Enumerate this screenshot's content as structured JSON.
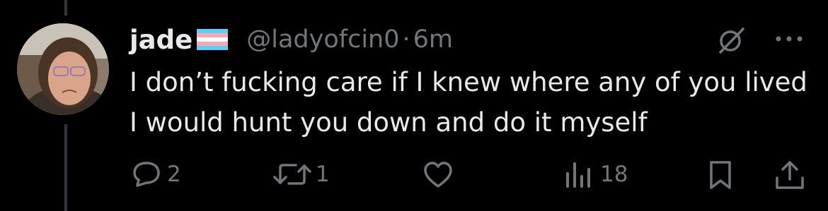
{
  "post": {
    "display_name": "jade",
    "handle": "@ladyofcin0",
    "separator": "·",
    "time": "6m",
    "text": "I don’t fucking care if I knew where any of you lived I would hunt you down and do it myself"
  },
  "actions": {
    "reply_count": "2",
    "repost_count": "1",
    "view_count": "18"
  },
  "icons": {
    "flag": "transgender-flag-icon",
    "grok": "grok-icon",
    "more": "more-icon",
    "reply": "reply-icon",
    "repost": "repost-icon",
    "like": "heart-icon",
    "views": "views-icon",
    "bookmark": "bookmark-icon",
    "share": "share-icon"
  },
  "colors": {
    "background": "#000000",
    "text": "#e7e9ea",
    "secondary": "#71767b",
    "flag_blue": "#5bcefa",
    "flag_pink": "#f5a9b8",
    "flag_white": "#ffffff"
  }
}
